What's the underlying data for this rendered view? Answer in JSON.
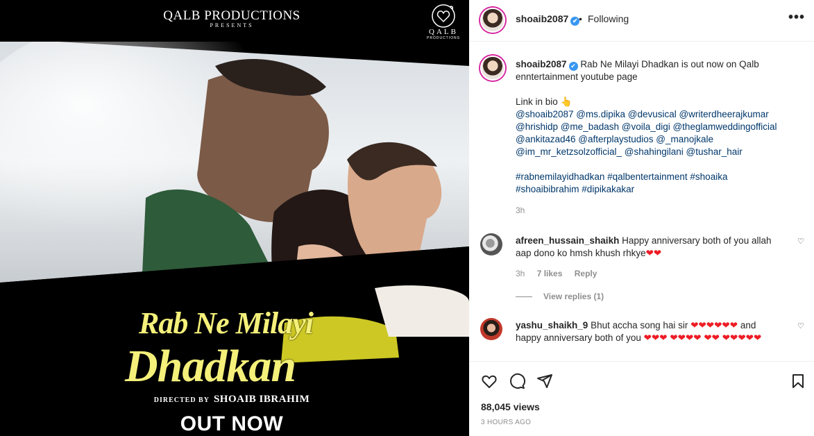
{
  "media": {
    "brand_title": "QALB PRODUCTIONS",
    "brand_presents": "PRESENTS",
    "logo_word": "QALB",
    "logo_sub": "PRODUCTIONS",
    "title_line1": "Rab Ne Milayi",
    "title_line2": "Dhadkan",
    "directed_by_label": "DIRECTED BY",
    "director": "SHOAIB IBRAHIM",
    "out_now": "OUT NOW"
  },
  "header": {
    "username": "shoaib2087",
    "separator": "•",
    "follow_status": "Following",
    "more": "•••"
  },
  "caption": {
    "username": "shoaib2087",
    "text": "Rab Ne Milayi Dhadkan is out now on Qalb enntertainment youtube page",
    "link_in_bio": "Link in bio 👆",
    "mentions": "@shoaib2087 @ms.dipika @devusical @writerdheerajkumar @hrishidp @me_badash @voila_digi @theglamweddingofficial @ankitazad46 @afterplaystudios @_manojkale @im_mr_ketzsolzofficial_ @shahingilani @tushar_hair",
    "hashtags": "#rabnemilayidhadkan #qalbentertainment #shoaika #shoaibibrahim #dipikakakar",
    "time": "3h"
  },
  "comments": [
    {
      "username": "afreen_hussain_shaikh",
      "text": "Happy anniversary both of you allah aap dono ko hmsh khush rhkye",
      "hearts": "❤❤",
      "time": "3h",
      "likes": "7 likes",
      "reply": "Reply",
      "view_replies": "View replies (1)"
    },
    {
      "username": "yashu_shaikh_9",
      "text_a": "Bhut accha song hai sir",
      "hearts_a": "❤❤❤❤❤❤",
      "text_b": "and happy anniversary both of you",
      "hearts_b": "❤❤❤ ❤❤❤❤ ❤❤ ❤❤❤❤❤"
    }
  ],
  "footer": {
    "views": "88,045 views",
    "ago": "3 HOURS AGO"
  },
  "colors": {
    "accent_link": "#00376b",
    "verified": "#3897f0",
    "heart": "#ed1c24",
    "title_yellow": "#f4f07a"
  }
}
